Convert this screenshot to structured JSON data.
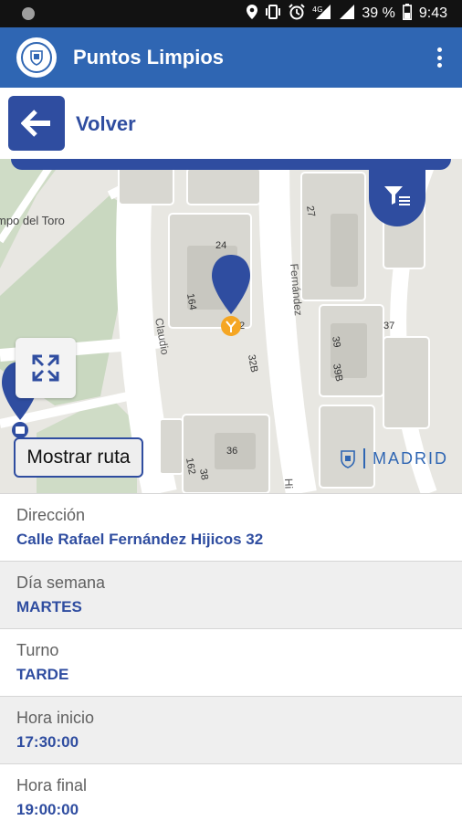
{
  "status_bar": {
    "battery": "39 %",
    "time": "9:43",
    "network": "4G"
  },
  "app_bar": {
    "title": "Puntos Limpios"
  },
  "back": {
    "label": "Volver"
  },
  "map": {
    "place_label": "mpo del Toro",
    "street_labels": [
      "Claudio",
      "Fernández",
      "Hi"
    ],
    "building_numbers": [
      "27",
      "24",
      "164",
      "2",
      "37",
      "39",
      "32B",
      "39B",
      "36",
      "162",
      "38"
    ],
    "route_button": "Mostrar ruta",
    "brand": "MADRID"
  },
  "details": [
    {
      "label": "Dirección",
      "value": "Calle Rafael Fernández Hijicos 32"
    },
    {
      "label": "Día semana",
      "value": "MARTES"
    },
    {
      "label": "Turno",
      "value": "TARDE"
    },
    {
      "label": "Hora inicio",
      "value": "17:30:00"
    },
    {
      "label": "Hora final",
      "value": "19:00:00"
    }
  ],
  "colors": {
    "appbar": "#2f66b3",
    "accent": "#2f4da0",
    "marker_yellow": "#f5a623"
  }
}
